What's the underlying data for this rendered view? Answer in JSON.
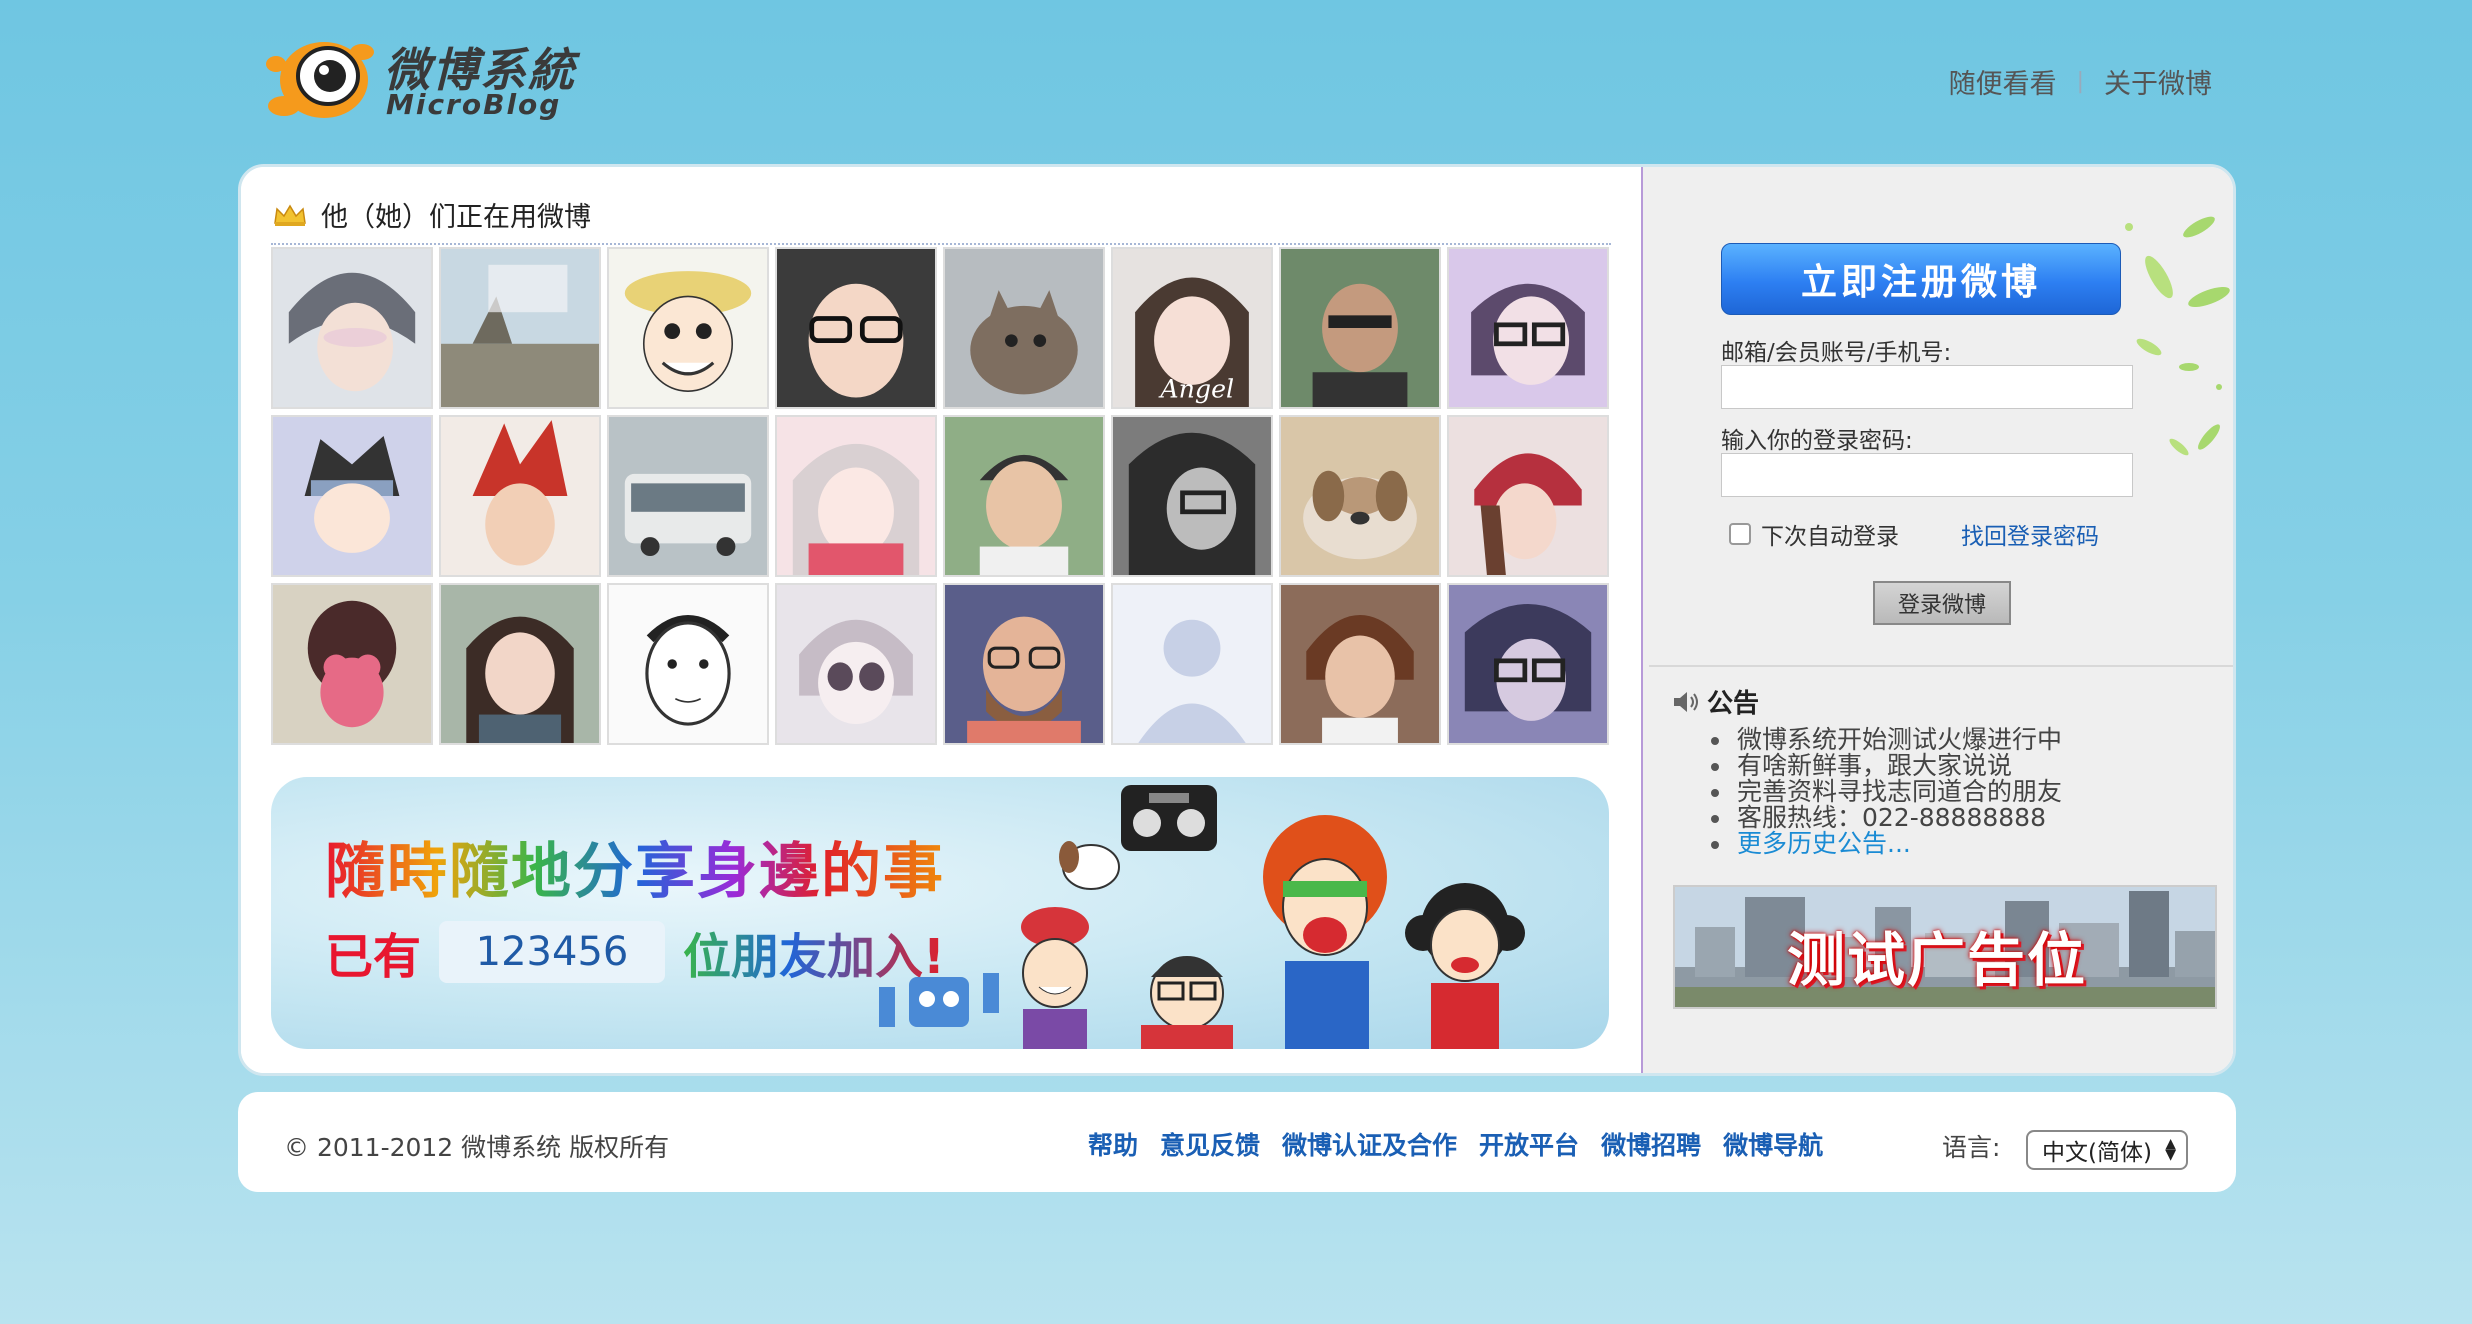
{
  "header": {
    "logo_cn": "微博系統",
    "logo_en": "MicroBlog",
    "nav": [
      {
        "label": "随便看看"
      },
      {
        "label": "关于微博"
      }
    ],
    "nav_separator": "|"
  },
  "users_section": {
    "title": "他（她）们正在用微博"
  },
  "banner": {
    "slogan": "隨時隨地分享身邊的事",
    "prefix": "已有",
    "count": "123456",
    "suffix": "位朋友加入!"
  },
  "login": {
    "register_label": "立即注册微博",
    "account_label": "邮箱/会员账号/手机号:",
    "account_value": "",
    "password_label": "输入你的登录密码:",
    "password_value": "",
    "remember_label": "下次自动登录",
    "forgot_label": "找回登录密码",
    "login_label": "登录微博"
  },
  "notice": {
    "title": "公告",
    "items": [
      "微博系统开始测试火爆进行中",
      "有啥新鲜事，跟大家说说",
      "完善资料寻找志同道合的朋友",
      "客服热线：022-88888888",
      "更多历史公告..."
    ]
  },
  "ad": {
    "text": "测试广告位"
  },
  "footer": {
    "copyright": "© 2011-2012 微博系统 版权所有",
    "links": [
      "帮助",
      "意见反馈",
      "微博认证及合作",
      "开放平台",
      "微博招聘",
      "微博导航"
    ],
    "lang_label": "语言:",
    "lang_selected": "中文(简体)"
  },
  "colors": {
    "page_bg": "#7dcbe4",
    "link_blue": "#1a5fb4",
    "register_blue": "#2d7ff2",
    "notice_more": "#1a8bd4"
  }
}
